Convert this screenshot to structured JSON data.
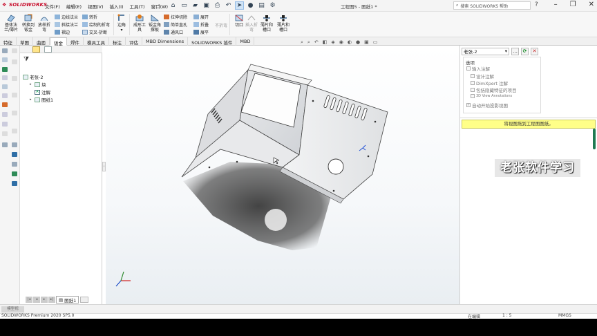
{
  "app": {
    "logo": "SOLIDWORKS",
    "document_title": "工程图5 - 图纸1 *",
    "menu": [
      "文件(F)",
      "编辑(E)",
      "视图(V)",
      "插入(I)",
      "工具(T)",
      "窗口(W)"
    ],
    "search_placeholder": "搜索 SOLIDWORKS 帮助"
  },
  "ribbon": {
    "big": [
      {
        "label1": "基体法",
        "label2": "兰/薄片"
      },
      {
        "label1": "转换到",
        "label2": "钣金"
      },
      {
        "label1": "放样折",
        "label2": "弯"
      }
    ],
    "col1": [
      "边线法兰",
      "斜接法兰",
      "褶边"
    ],
    "col2": [
      "转折",
      "绘制的折弯",
      "交叉-折断"
    ],
    "corner": "边角",
    "formtool": {
      "label1": "成形工",
      "label2": "具"
    },
    "gusset": {
      "label1": "钣金角",
      "label2": "撑板"
    },
    "col3": [
      "拉伸切除",
      "简单直孔",
      "通风口"
    ],
    "col4": [
      "展开",
      "折叠",
      "展平"
    ],
    "nofold": "不折弯",
    "rip": "切口",
    "insertbend": {
      "label1": "插入折",
      "label2": "弯"
    },
    "solidcorner": {
      "label1": "薄片和",
      "label2": "槽口"
    },
    "tab_slot": {
      "label1": "薄片和",
      "label2": "槽口"
    }
  },
  "tabs": [
    "特征",
    "草图",
    "曲面",
    "钣金",
    "焊件",
    "模具工具",
    "标注",
    "评估",
    "MBD Dimensions",
    "SOLIDWORKS 插件",
    "MBD"
  ],
  "active_tab": "钣金",
  "tree": {
    "root": "老张-2",
    "items": [
      {
        "label": "块",
        "expandable": true
      },
      {
        "label": "注解",
        "expandable": false
      },
      {
        "label": "图纸1",
        "expandable": true
      }
    ]
  },
  "pane": {
    "combo_value": "老张-2",
    "options_title": "选项",
    "options": [
      {
        "label": "输入注解",
        "checked": false
      },
      {
        "label": "设计注解",
        "checked": false
      },
      {
        "label": "DimXpert 注解",
        "checked": false
      },
      {
        "label": "包括隐藏特征的项目",
        "checked": false
      },
      {
        "label": "3D View Annotations",
        "checked": false
      },
      {
        "label": "自动开始投影视图",
        "checked": true
      }
    ],
    "hint": "将视图拖到工程图图纸。"
  },
  "watermark": "老张软件学习",
  "sheet_tab": "图纸1",
  "model_tab": "模型视",
  "status": {
    "left": "SOLIDWORKS Premium 2020 SP5.0",
    "mid": "在编辑",
    "scale": "1 : 5",
    "units": "MMGS"
  },
  "colors": {
    "hint_bg": "#ffff88",
    "logo": "#c8102e",
    "pane_scroll": "#1f7a52"
  }
}
